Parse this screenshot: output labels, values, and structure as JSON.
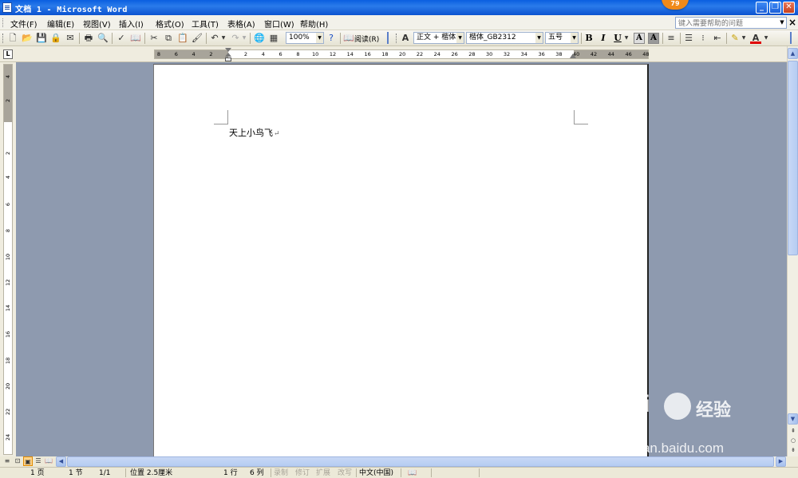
{
  "window": {
    "title": "文档 1 - Microsoft Word",
    "badge": "79",
    "minimize_icon": "minimize-icon",
    "maximize_icon": "restore-icon",
    "close_icon": "close-icon"
  },
  "menu": {
    "items": [
      "文件(F)",
      "编辑(E)",
      "视图(V)",
      "插入(I)",
      "格式(O)",
      "工具(T)",
      "表格(A)",
      "窗口(W)",
      "帮助(H)"
    ],
    "help_placeholder": "键入需要帮助的问题"
  },
  "toolbar": {
    "zoom": "100%",
    "read_label": "阅读(R)",
    "style": "正文 + 楷体",
    "font": "楷体_GB2312",
    "size": "五号",
    "bold": "B",
    "italic": "I",
    "underline": "U"
  },
  "ruler": {
    "h_numbers": [
      "8",
      "6",
      "4",
      "2",
      "2",
      "4",
      "6",
      "8",
      "10",
      "12",
      "14",
      "16",
      "18",
      "20",
      "22",
      "24",
      "26",
      "28",
      "30",
      "32",
      "34",
      "36",
      "38",
      "40",
      "42",
      "44",
      "46",
      "48"
    ],
    "v_numbers": [
      "4",
      "2",
      "2",
      "4",
      "6",
      "8",
      "10",
      "12",
      "14",
      "16",
      "18",
      "20",
      "22",
      "24"
    ],
    "corner": "L"
  },
  "document": {
    "text": "天上小鸟飞",
    "para_mark": "↵"
  },
  "statusbar": {
    "page": "1 页",
    "section": "1 节",
    "page_of": "1/1",
    "position": "位置 2.5厘米",
    "line": "1 行",
    "column": "6 列",
    "rec": "录制",
    "trk": "修订",
    "ext": "扩展",
    "ovr": "改写",
    "language": "中文(中国)"
  },
  "watermark": {
    "brand": "Bai",
    "brand2": "经验",
    "url": "jingyan.baidu.com"
  }
}
